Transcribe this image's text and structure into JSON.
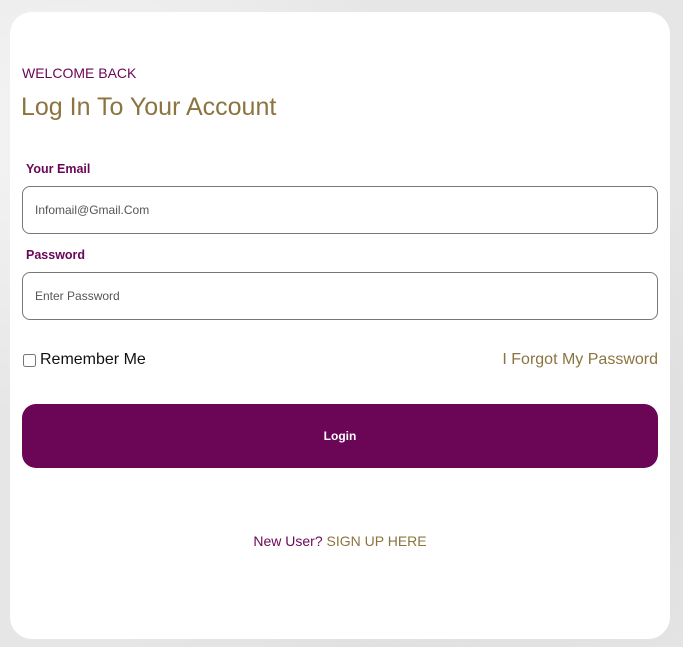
{
  "header": {
    "eyebrow": "WELCOME BACK",
    "title": "Log In To Your Account"
  },
  "form": {
    "email": {
      "label": "Your Email",
      "placeholder": "Infomail@Gmail.Com",
      "value": ""
    },
    "password": {
      "label": "Password",
      "placeholder": "Enter Password",
      "value": ""
    },
    "remember": {
      "label": "Remember Me",
      "checked": false
    },
    "forgot_label": "I Forgot My Password",
    "submit_label": "Login"
  },
  "footer": {
    "prompt": "New User? ",
    "signup_label": "SIGN UP HERE"
  },
  "colors": {
    "primary": "#6b0657",
    "accent": "#8c7440",
    "card": "#ffffff",
    "background": "#e6e6e6"
  }
}
